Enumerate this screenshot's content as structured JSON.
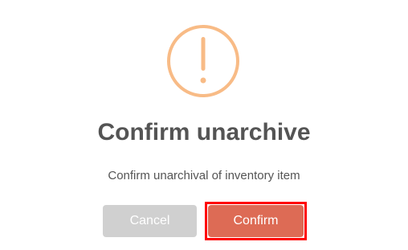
{
  "dialog": {
    "icon": "warning-exclamation-icon",
    "title": "Confirm unarchive",
    "message": "Confirm unarchival of inventory item",
    "buttons": {
      "cancel_label": "Cancel",
      "confirm_label": "Confirm"
    },
    "colors": {
      "icon": "#f8bb86",
      "title_text": "#545454",
      "cancel_bg": "#d0d0d0",
      "confirm_bg": "#dd6b55",
      "highlight_outline": "#ff0000"
    }
  }
}
